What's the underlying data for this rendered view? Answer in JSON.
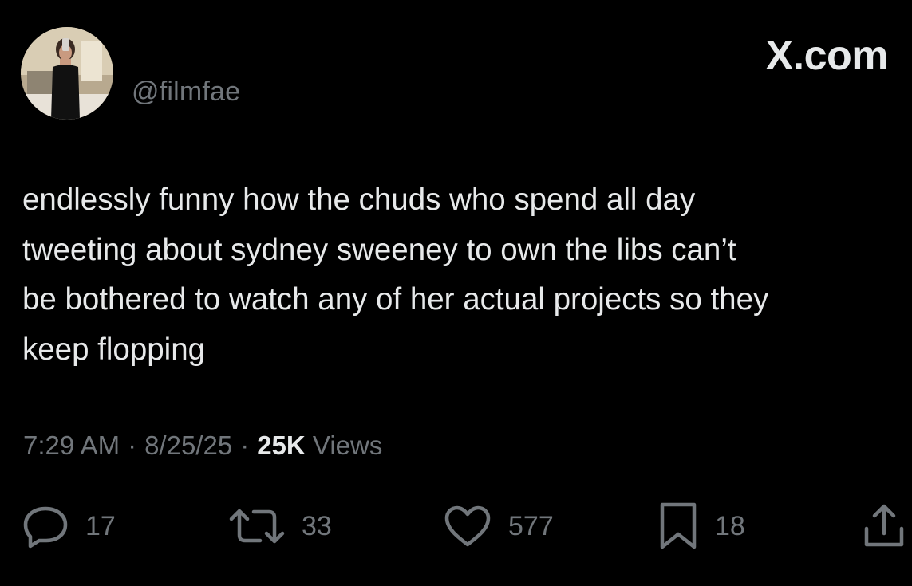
{
  "header": {
    "handle": "@filmfae",
    "brand": "X.com"
  },
  "tweet": {
    "text": "endlessly funny how the chuds who spend all day\ntweeting about sydney sweeney to own the libs can’t\nbe bothered to watch any of her actual projects so they\nkeep flopping",
    "time": "7:29 AM",
    "date": "8/25/25",
    "separator": "·",
    "views_count": "25K",
    "views_label": "Views"
  },
  "actions": {
    "reply_count": "17",
    "repost_count": "33",
    "like_count": "577",
    "bookmark_count": "18"
  },
  "icons": {
    "reply": "reply-icon",
    "repost": "repost-icon",
    "like": "heart-icon",
    "bookmark": "bookmark-icon",
    "share": "share-icon"
  },
  "colors": {
    "background": "#000000",
    "primary_text": "#e7e9ea",
    "secondary_text": "#71767b"
  }
}
